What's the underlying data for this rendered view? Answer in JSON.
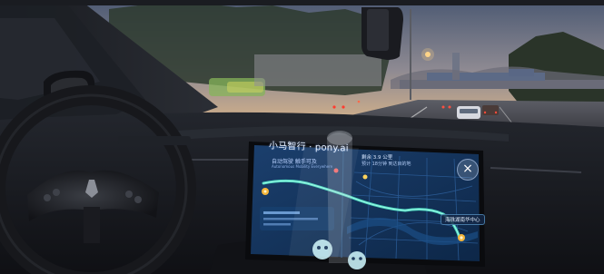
{
  "screen": {
    "brand": "小马智行 · pony.ai",
    "tagline_cn": "自动驾驶 触手可及",
    "tagline_en": "Autonomous Mobility Everywhere",
    "nav_title": "剩余 3.9 公里",
    "nav_subtitle": "预计 18分钟 到达目的地",
    "destination": "海珠湖南华中心",
    "close_symbol": "×"
  },
  "colors": {
    "sky_top": "#4d5a73",
    "sky_mid": "#8e8a92",
    "sky_horizon": "#d8b48a",
    "screen_bg": "#12345e",
    "route": "#4fe3c6",
    "dashboard": "#15171c"
  },
  "icons": {
    "close": "close-icon",
    "location_pin": "location-pin-icon",
    "mascot": "mascot-icon"
  }
}
